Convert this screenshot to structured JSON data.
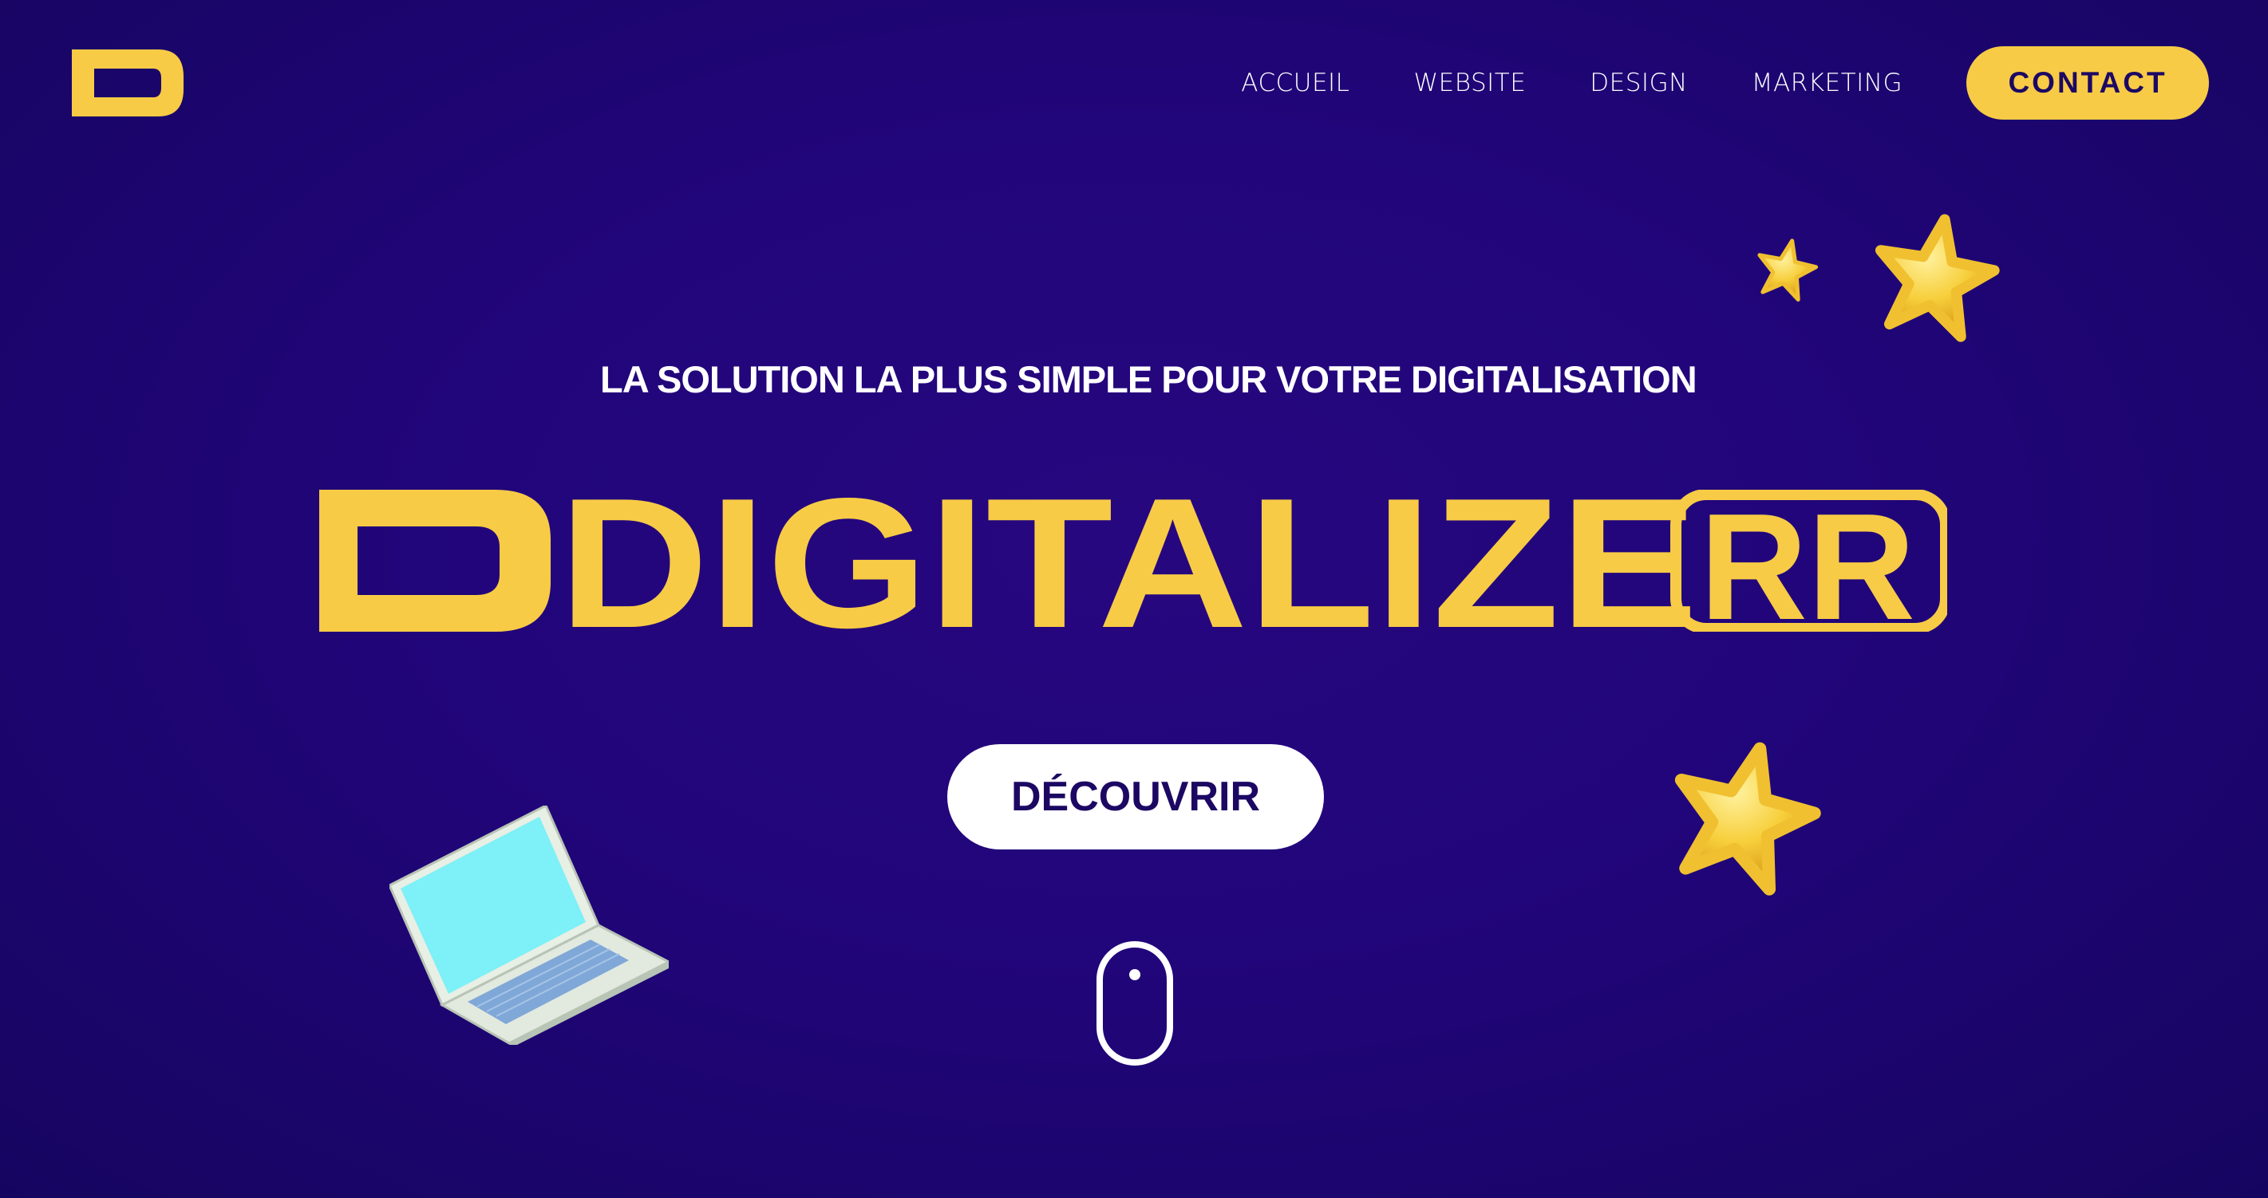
{
  "header": {
    "logo_letter": "D",
    "nav": {
      "accueil": "ACCUEIL",
      "website": "WEBSITE",
      "design": "DESIGN",
      "marketing": "MARKETING",
      "contact": "CONTACT"
    }
  },
  "hero": {
    "tagline": "LA SOLUTION LA PLUS SIMPLE POUR VOTRE DIGITALISATION",
    "headline_solid": "DIGITALIZE",
    "headline_outline": "RR",
    "cta_label": "DÉCOUVRIR"
  },
  "decorations": {
    "icons": [
      "star-icon",
      "laptop-icon",
      "scroll-mouse-icon"
    ]
  },
  "colors": {
    "background": "#21057a",
    "accent_yellow": "#f7cb45",
    "text_dark": "#1c0863",
    "white": "#ffffff",
    "laptop_screen": "#7ef0f7"
  }
}
